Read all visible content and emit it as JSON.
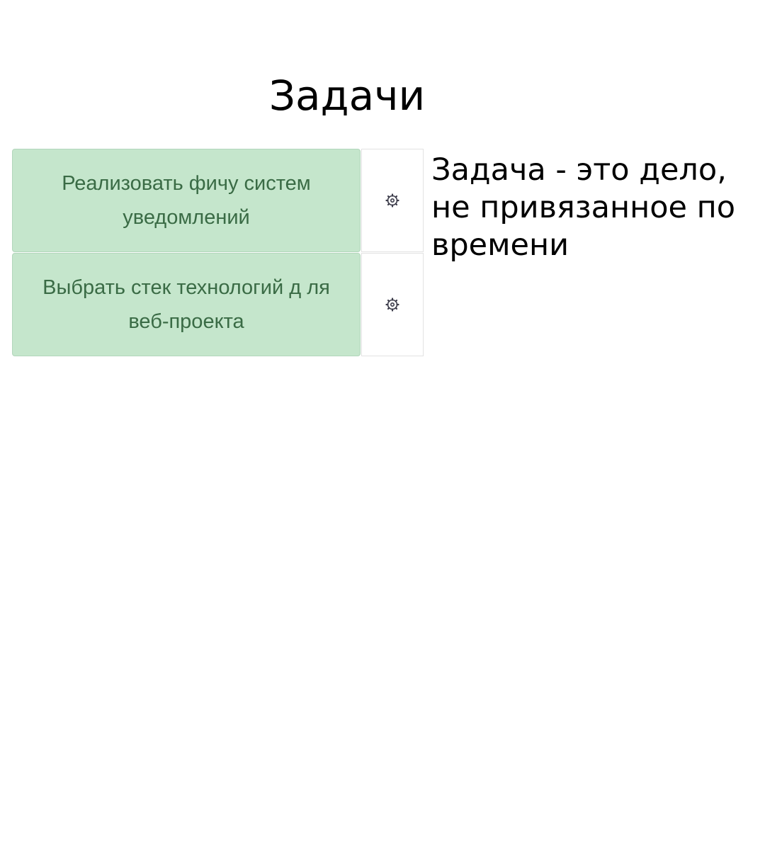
{
  "page": {
    "title": "Задачи"
  },
  "tasks": [
    {
      "title": "Реализовать фичу систем уведомлений",
      "settings_icon": "gear-icon"
    },
    {
      "title": "Выбрать стек технологий д ля веб-проекта",
      "settings_icon": "gear-icon"
    }
  ],
  "description": {
    "text": "Задача - это дело, не привязанное по времени"
  },
  "colors": {
    "task_background": "#c5e6cc",
    "task_text": "#3a6b45",
    "settings_background": "#ffffff"
  }
}
